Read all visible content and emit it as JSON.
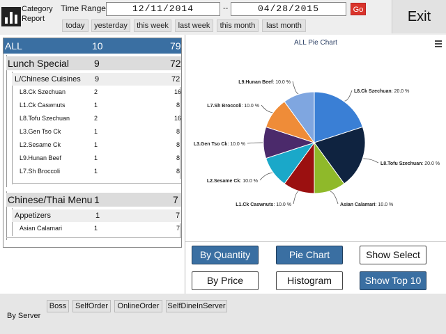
{
  "header": {
    "title": "Category Report",
    "time_range_label": "Time Range:",
    "start_date": "12/11/2014",
    "separator": "--",
    "end_date": "04/28/2015",
    "go_label": "Go",
    "quick_ranges": [
      "today",
      "yesterday",
      "this week",
      "last week",
      "this month",
      "last month"
    ],
    "exit_label": "Exit"
  },
  "tree": {
    "all": {
      "name": "ALL",
      "qty": "10",
      "total": "79"
    },
    "groups": [
      {
        "name": "Lunch Special",
        "qty": "9",
        "total": "72",
        "subs": [
          {
            "name": "L/Chinese Cuisines",
            "qty": "9",
            "total": "72",
            "items": [
              {
                "name": "L8.Ck Szechuan",
                "qty": "2",
                "total": "16"
              },
              {
                "name": "L1.Ck Caswnuts",
                "qty": "1",
                "total": "8"
              },
              {
                "name": "L8.Tofu Szechuan",
                "qty": "2",
                "total": "16"
              },
              {
                "name": "L3.Gen Tso Ck",
                "qty": "1",
                "total": "8"
              },
              {
                "name": "L2.Sesame Ck",
                "qty": "1",
                "total": "8"
              },
              {
                "name": "L9.Hunan Beef",
                "qty": "1",
                "total": "8"
              },
              {
                "name": "L7.Sh Broccoli",
                "qty": "1",
                "total": "8"
              }
            ]
          }
        ]
      },
      {
        "name": "Chinese/Thai Menu",
        "qty": "1",
        "total": "7",
        "subs": [
          {
            "name": "Appetizers",
            "qty": "1",
            "total": "7",
            "items": [
              {
                "name": "Asian Calamari",
                "qty": "1",
                "total": "7"
              }
            ]
          }
        ]
      }
    ]
  },
  "chart_title": "ALL Pie Chart",
  "chart_data": {
    "type": "pie",
    "title": "ALL Pie Chart",
    "slices": [
      {
        "label": "L8.Ck Szechuan",
        "value": 20.0,
        "display": "20.0 %",
        "color": "#3a7fd5"
      },
      {
        "label": "L8.Tofu Szechuan",
        "value": 20.0,
        "display": "20.0 %",
        "color": "#0f2340"
      },
      {
        "label": "Asian Calamari",
        "value": 10.0,
        "display": "10.0 %",
        "color": "#8fb92a"
      },
      {
        "label": "L1.Ck Caswnuts",
        "value": 10.0,
        "display": "10.0 %",
        "color": "#9b1010"
      },
      {
        "label": "L2.Sesame Ck",
        "value": 10.0,
        "display": "10.0 %",
        "color": "#1aa8c9"
      },
      {
        "label": "L3.Gen Tso Ck",
        "value": 10.0,
        "display": "10.0 %",
        "color": "#4b2a6b"
      },
      {
        "label": "L7.Sh Broccoli",
        "value": 10.0,
        "display": "10.0 %",
        "color": "#ef8c38"
      },
      {
        "label": "L9.Hunan Beef",
        "value": 10.0,
        "display": "10.0 %",
        "color": "#7fa6e0"
      }
    ]
  },
  "controls": {
    "by_quantity": "By Quantity",
    "by_price": "By Price",
    "pie_chart": "Pie Chart",
    "histogram": "Histogram",
    "show_select": "Show Select",
    "show_top": "Show Top 10"
  },
  "footer": {
    "servers": [
      "Boss",
      "SelfOrder",
      "OnlineOrder",
      "SelfDineInServer"
    ],
    "by_server": "By Server"
  },
  "colors": {
    "accent": "#3a6fa2",
    "go": "#d9342b"
  }
}
